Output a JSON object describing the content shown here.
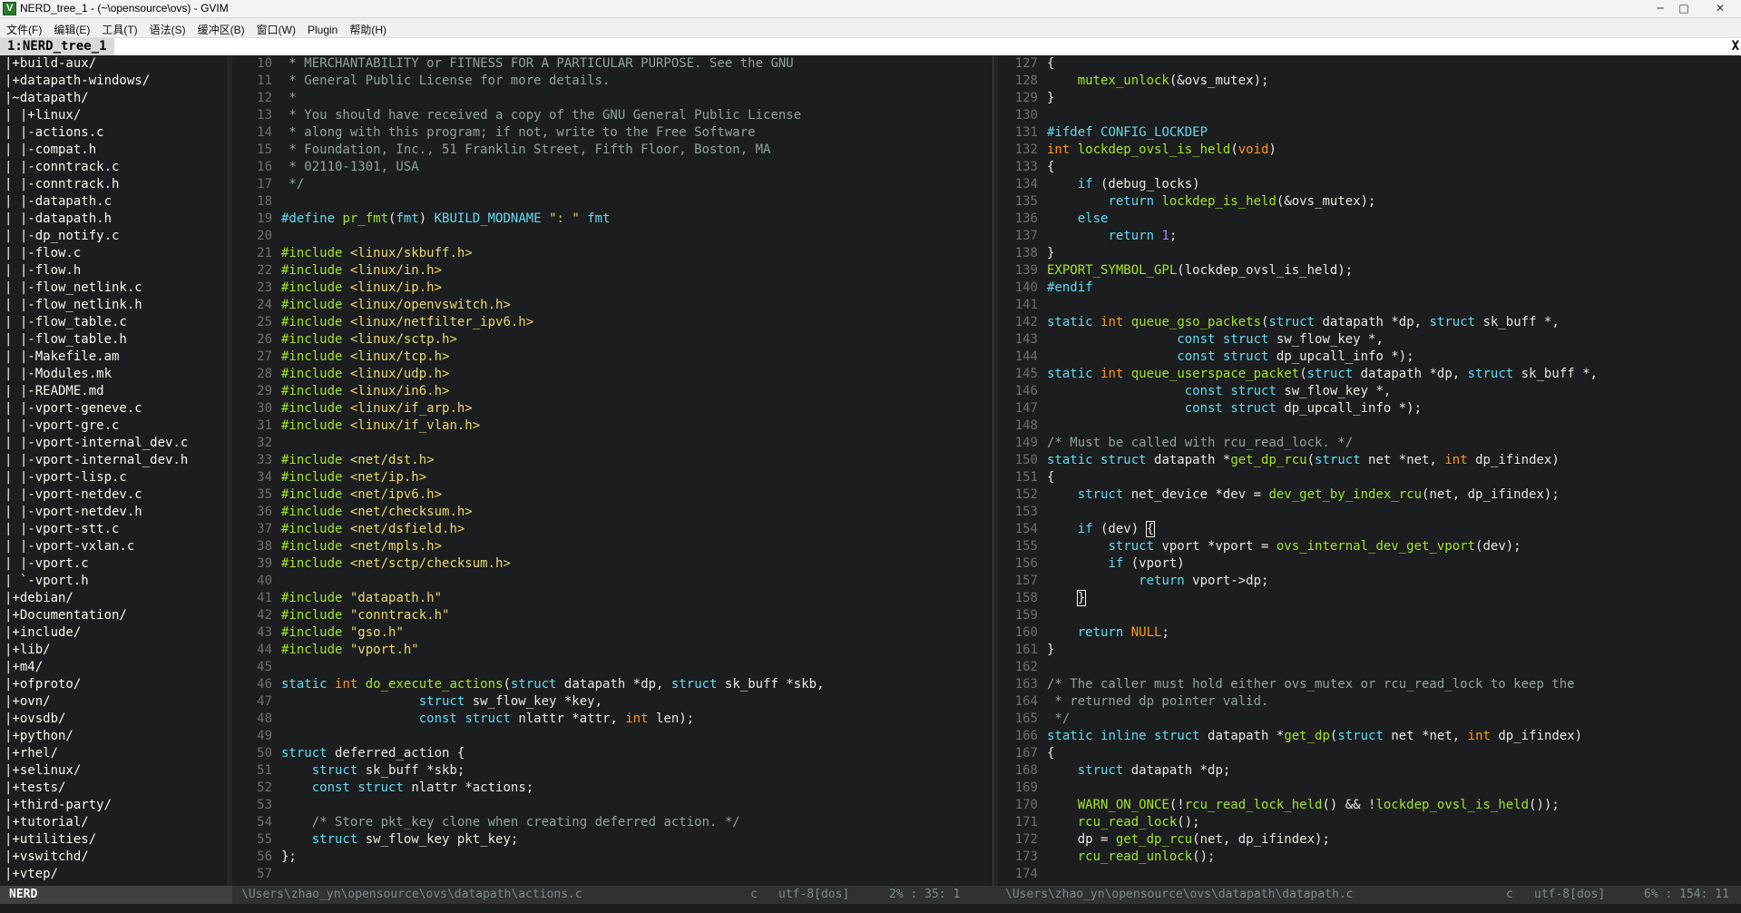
{
  "window": {
    "title": "NERD_tree_1 - (~\\opensource\\ovs) - GVIM"
  },
  "menu": [
    "文件(F)",
    "编辑(E)",
    "工具(T)",
    "语法(S)",
    "缓冲区(B)",
    "窗口(W)",
    "Plugin",
    "帮助(H)"
  ],
  "tab": {
    "label": "1:NERD_tree_1",
    "close": "X"
  },
  "tree": [
    "|+build-aux/",
    "|+datapath-windows/",
    "|~datapath/",
    "| |+linux/",
    "| |-actions.c",
    "| |-compat.h",
    "| |-conntrack.c",
    "| |-conntrack.h",
    "| |-datapath.c",
    "| |-datapath.h",
    "| |-dp_notify.c",
    "| |-flow.c",
    "| |-flow.h",
    "| |-flow_netlink.c",
    "| |-flow_netlink.h",
    "| |-flow_table.c",
    "| |-flow_table.h",
    "| |-Makefile.am",
    "| |-Modules.mk",
    "| |-README.md",
    "| |-vport-geneve.c",
    "| |-vport-gre.c",
    "| |-vport-internal_dev.c",
    "| |-vport-internal_dev.h",
    "| |-vport-lisp.c",
    "| |-vport-netdev.c",
    "| |-vport-netdev.h",
    "| |-vport-stt.c",
    "| |-vport-vxlan.c",
    "| |-vport.c",
    "| `-vport.h",
    "|+debian/",
    "|+Documentation/",
    "|+include/",
    "|+lib/",
    "|+m4/",
    "|+ofproto/",
    "|+ovn/",
    "|+ovsdb/",
    "|+python/",
    "|+rhel/",
    "|+selinux/",
    "|+tests/",
    "|+third-party/",
    "|+tutorial/",
    "|+utilities/",
    "|+vswitchd/",
    "|+vtep/"
  ],
  "left_code": [
    {
      "n": "10",
      "h": "<span class=\"c\"> * MERCHANTABILITY or FITNESS FOR A PARTICULAR PURPOSE. See the GNU</span>"
    },
    {
      "n": "11",
      "h": "<span class=\"c\"> * General Public License for more details.</span>"
    },
    {
      "n": "12",
      "h": "<span class=\"c\"> *</span>"
    },
    {
      "n": "13",
      "h": "<span class=\"c\"> * You should have received a copy of the GNU General Public License</span>"
    },
    {
      "n": "14",
      "h": "<span class=\"c\"> * along with this program; if not, write to the Free Software</span>"
    },
    {
      "n": "15",
      "h": "<span class=\"c\"> * Foundation, Inc., 51 Franklin Street, Fifth Floor, Boston, MA</span>"
    },
    {
      "n": "16",
      "h": "<span class=\"c\"> * 02110-1301, USA</span>"
    },
    {
      "n": "17",
      "h": "<span class=\"c\"> */</span>"
    },
    {
      "n": "18",
      "h": ""
    },
    {
      "n": "19",
      "h": "<span class=\"k\">#define</span> <span class=\"f\">pr_fmt</span>(<span class=\"k\">fmt</span>) <span class=\"k\">KBUILD_MODNAME</span> <span class=\"s\">\": \"</span> <span class=\"k\">fmt</span>"
    },
    {
      "n": "20",
      "h": ""
    },
    {
      "n": "21",
      "h": "<span class=\"pp\">#include</span> <span class=\"s\">&lt;linux/skbuff.h&gt;</span>"
    },
    {
      "n": "22",
      "h": "<span class=\"pp\">#include</span> <span class=\"s\">&lt;linux/in.h&gt;</span>"
    },
    {
      "n": "23",
      "h": "<span class=\"pp\">#include</span> <span class=\"s\">&lt;linux/ip.h&gt;</span>"
    },
    {
      "n": "24",
      "h": "<span class=\"pp\">#include</span> <span class=\"s\">&lt;linux/openvswitch.h&gt;</span>"
    },
    {
      "n": "25",
      "h": "<span class=\"pp\">#include</span> <span class=\"s\">&lt;linux/netfilter_ipv6.h&gt;</span>"
    },
    {
      "n": "26",
      "h": "<span class=\"pp\">#include</span> <span class=\"s\">&lt;linux/sctp.h&gt;</span>"
    },
    {
      "n": "27",
      "h": "<span class=\"pp\">#include</span> <span class=\"s\">&lt;linux/tcp.h&gt;</span>"
    },
    {
      "n": "28",
      "h": "<span class=\"pp\">#include</span> <span class=\"s\">&lt;linux/udp.h&gt;</span>"
    },
    {
      "n": "29",
      "h": "<span class=\"pp\">#include</span> <span class=\"s\">&lt;linux/in6.h&gt;</span>"
    },
    {
      "n": "30",
      "h": "<span class=\"pp\">#include</span> <span class=\"s\">&lt;linux/if_arp.h&gt;</span>"
    },
    {
      "n": "31",
      "h": "<span class=\"pp\">#include</span> <span class=\"s\">&lt;linux/if_vlan.h&gt;</span>"
    },
    {
      "n": "32",
      "h": ""
    },
    {
      "n": "33",
      "h": "<span class=\"pp\">#include</span> <span class=\"s\">&lt;net/dst.h&gt;</span>"
    },
    {
      "n": "34",
      "h": "<span class=\"pp\">#include</span> <span class=\"s\">&lt;net/ip.h&gt;</span>"
    },
    {
      "n": "35",
      "h": "<span class=\"pp\">#include</span> <span class=\"s\">&lt;net/ipv6.h&gt;</span>"
    },
    {
      "n": "36",
      "h": "<span class=\"pp\">#include</span> <span class=\"s\">&lt;net/checksum.h&gt;</span>"
    },
    {
      "n": "37",
      "h": "<span class=\"pp\">#include</span> <span class=\"s\">&lt;net/dsfield.h&gt;</span>"
    },
    {
      "n": "38",
      "h": "<span class=\"pp\">#include</span> <span class=\"s\">&lt;net/mpls.h&gt;</span>"
    },
    {
      "n": "39",
      "h": "<span class=\"pp\">#include</span> <span class=\"s\">&lt;net/sctp/checksum.h&gt;</span>"
    },
    {
      "n": "40",
      "h": ""
    },
    {
      "n": "41",
      "h": "<span class=\"pp\">#include</span> <span class=\"s\">\"datapath.h\"</span>"
    },
    {
      "n": "42",
      "h": "<span class=\"pp\">#include</span> <span class=\"s\">\"conntrack.h\"</span>"
    },
    {
      "n": "43",
      "h": "<span class=\"pp\">#include</span> <span class=\"s\">\"gso.h\"</span>"
    },
    {
      "n": "44",
      "h": "<span class=\"pp\">#include</span> <span class=\"s\">\"vport.h\"</span>"
    },
    {
      "n": "45",
      "h": ""
    },
    {
      "n": "46",
      "h": "<span class=\"k\">static</span> <span class=\"t\">int</span> <span class=\"f\">do_execute_actions</span>(<span class=\"k\">struct</span> datapath *dp, <span class=\"k\">struct</span> sk_buff *skb,"
    },
    {
      "n": "47",
      "h": "                  <span class=\"k\">struct</span> sw_flow_key *key,"
    },
    {
      "n": "48",
      "h": "                  <span class=\"k\">const</span> <span class=\"k\">struct</span> nlattr *attr, <span class=\"t\">int</span> len);"
    },
    {
      "n": "49",
      "h": ""
    },
    {
      "n": "50",
      "h": "<span class=\"k\">struct</span> deferred_action {"
    },
    {
      "n": "51",
      "h": "    <span class=\"k\">struct</span> sk_buff *skb;"
    },
    {
      "n": "52",
      "h": "    <span class=\"k\">const</span> <span class=\"k\">struct</span> nlattr *actions;"
    },
    {
      "n": "53",
      "h": ""
    },
    {
      "n": "54",
      "h": "    <span class=\"c\">/* Store pkt_key clone when creating deferred action. */</span>"
    },
    {
      "n": "55",
      "h": "    <span class=\"k\">struct</span> sw_flow_key pkt_key;"
    },
    {
      "n": "56",
      "h": "};"
    },
    {
      "n": "57",
      "h": ""
    }
  ],
  "right_code": [
    {
      "n": "127",
      "h": "{"
    },
    {
      "n": "128",
      "h": "    <span class=\"f\">mutex_unlock</span>(&amp;ovs_mutex);"
    },
    {
      "n": "129",
      "h": "}"
    },
    {
      "n": "130",
      "h": ""
    },
    {
      "n": "131",
      "h": "<span class=\"k\">#ifdef</span> <span class=\"k\">CONFIG_LOCKDEP</span>"
    },
    {
      "n": "132",
      "h": "<span class=\"t\">int</span> <span class=\"f\">lockdep_ovsl_is_held</span>(<span class=\"t\">void</span>)"
    },
    {
      "n": "133",
      "h": "{"
    },
    {
      "n": "134",
      "h": "    <span class=\"k\">if</span> (debug_locks)"
    },
    {
      "n": "135",
      "h": "        <span class=\"k\">return</span> <span class=\"f\">lockdep_is_held</span>(&amp;ovs_mutex);"
    },
    {
      "n": "136",
      "h": "    <span class=\"k\">else</span>"
    },
    {
      "n": "137",
      "h": "        <span class=\"k\">return</span> <span class=\"n\">1</span>;"
    },
    {
      "n": "138",
      "h": "}"
    },
    {
      "n": "139",
      "h": "<span class=\"f\">EXPORT_SYMBOL_GPL</span>(lockdep_ovsl_is_held);"
    },
    {
      "n": "140",
      "h": "<span class=\"k\">#endif</span>"
    },
    {
      "n": "141",
      "h": ""
    },
    {
      "n": "142",
      "h": "<span class=\"k\">static</span> <span class=\"t\">int</span> <span class=\"f\">queue_gso_packets</span>(<span class=\"k\">struct</span> datapath *dp, <span class=\"k\">struct</span> sk_buff *,"
    },
    {
      "n": "143",
      "h": "                 <span class=\"k\">const</span> <span class=\"k\">struct</span> sw_flow_key *,"
    },
    {
      "n": "144",
      "h": "                 <span class=\"k\">const</span> <span class=\"k\">struct</span> dp_upcall_info *);"
    },
    {
      "n": "145",
      "h": "<span class=\"k\">static</span> <span class=\"t\">int</span> <span class=\"f\">queue_userspace_packet</span>(<span class=\"k\">struct</span> datapath *dp, <span class=\"k\">struct</span> sk_buff *,"
    },
    {
      "n": "146",
      "h": "                  <span class=\"k\">const</span> <span class=\"k\">struct</span> sw_flow_key *,"
    },
    {
      "n": "147",
      "h": "                  <span class=\"k\">const</span> <span class=\"k\">struct</span> dp_upcall_info *);"
    },
    {
      "n": "148",
      "h": ""
    },
    {
      "n": "149",
      "h": "<span class=\"c\">/* Must be called with rcu_read_lock. */</span>"
    },
    {
      "n": "150",
      "h": "<span class=\"k\">static</span> <span class=\"k\">struct</span> datapath *<span class=\"f\">get_dp_rcu</span>(<span class=\"k\">struct</span> net *net, <span class=\"t\">int</span> dp_ifindex)"
    },
    {
      "n": "151",
      "h": "{"
    },
    {
      "n": "152",
      "h": "    <span class=\"k\">struct</span> net_device *dev = <span class=\"f\">dev_get_by_index_rcu</span>(net, dp_ifindex);"
    },
    {
      "n": "153",
      "h": ""
    },
    {
      "n": "154",
      "h": "    <span class=\"k\">if</span> (dev) <span style=\"outline:1px solid #f8f8f2\">{</span>"
    },
    {
      "n": "155",
      "h": "        <span class=\"k\">struct</span> vport *vport = <span class=\"f\">ovs_internal_dev_get_vport</span>(dev);"
    },
    {
      "n": "156",
      "h": "        <span class=\"k\">if</span> (vport)"
    },
    {
      "n": "157",
      "h": "            <span class=\"k\">return</span> vport-&gt;dp;"
    },
    {
      "n": "158",
      "h": "    <span style=\"outline:1px solid #f8f8f2\">}</span>"
    },
    {
      "n": "159",
      "h": ""
    },
    {
      "n": "160",
      "h": "    <span class=\"k\">return</span> <span class=\"t\">NULL</span>;"
    },
    {
      "n": "161",
      "h": "}"
    },
    {
      "n": "162",
      "h": ""
    },
    {
      "n": "163",
      "h": "<span class=\"c\">/* The caller must hold either ovs_mutex or rcu_read_lock to keep the</span>"
    },
    {
      "n": "164",
      "h": "<span class=\"c\"> * returned dp pointer valid.</span>"
    },
    {
      "n": "165",
      "h": "<span class=\"c\"> */</span>"
    },
    {
      "n": "166",
      "h": "<span class=\"k\">static</span> <span class=\"k\">inline</span> <span class=\"k\">struct</span> datapath *<span class=\"f\">get_dp</span>(<span class=\"k\">struct</span> net *net, <span class=\"t\">int</span> dp_ifindex)"
    },
    {
      "n": "167",
      "h": "{"
    },
    {
      "n": "168",
      "h": "    <span class=\"k\">struct</span> datapath *dp;"
    },
    {
      "n": "169",
      "h": ""
    },
    {
      "n": "170",
      "h": "    <span class=\"f\">WARN_ON_ONCE</span>(!<span class=\"f\">rcu_read_lock_held</span>() &amp;&amp; !<span class=\"f\">lockdep_ovsl_is_held</span>());"
    },
    {
      "n": "171",
      "h": "    <span class=\"f\">rcu_read_lock</span>();"
    },
    {
      "n": "172",
      "h": "    dp = <span class=\"f\">get_dp_rcu</span>(net, dp_ifindex);"
    },
    {
      "n": "173",
      "h": "    <span class=\"f\">rcu_read_unlock</span>();"
    },
    {
      "n": "174",
      "h": ""
    }
  ],
  "status": {
    "nerd": "NERD",
    "left_path": "\\Users\\zhao_yn\\opensource\\ovs\\datapath\\actions.c",
    "left_ft": "c",
    "left_enc": "utf-8[dos]",
    "left_pos": "2% :  35:  1",
    "right_path": "\\Users\\zhao_yn\\opensource\\ovs\\datapath\\datapath.c",
    "right_ft": "c",
    "right_enc": "utf-8[dos]",
    "right_pos": "6% : 154: 11"
  },
  "colors": {
    "bg": "#1b1d1e",
    "keyword": "#66d9ef",
    "type": "#fd971f",
    "string": "#e6db74",
    "function": "#a6e22e",
    "comment": "#93a1a1"
  }
}
